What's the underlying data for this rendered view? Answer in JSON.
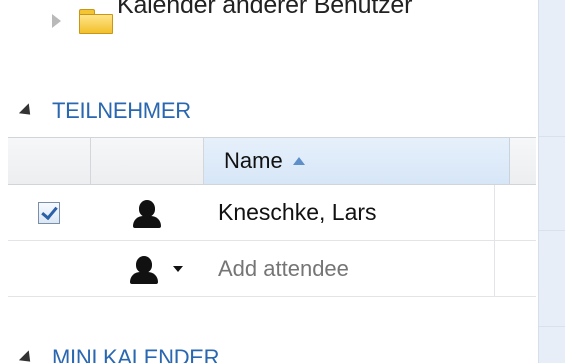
{
  "tree": {
    "item_label": "Kalender anderer Benutzer"
  },
  "participants": {
    "title": "TEILNEHMER",
    "columns": {
      "check": "",
      "icon": "",
      "name": "Name"
    },
    "rows": [
      {
        "checked": true,
        "name": "Kneschke, Lars",
        "icon": "person-icon"
      }
    ],
    "add_row": {
      "placeholder": "Add attendee",
      "icon": "person-icon",
      "menu_icon": "chevron-down-icon"
    }
  },
  "mini_calendar": {
    "title": "MINI KALENDER"
  }
}
